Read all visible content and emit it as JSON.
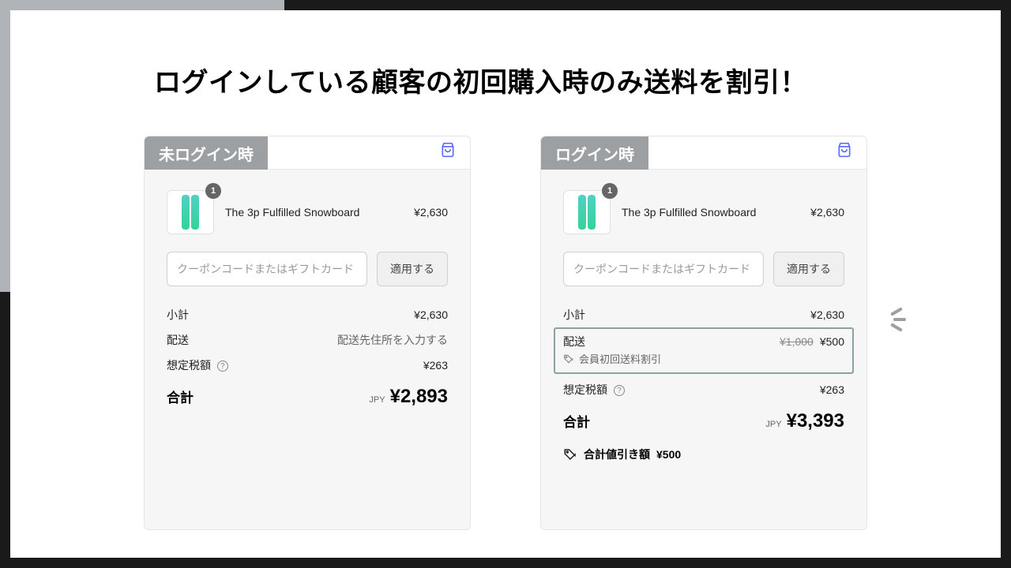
{
  "page_title": "ログインしている顧客の初回購入時のみ送料を割引！",
  "common": {
    "coupon_placeholder": "クーポンコードまたはギフトカード",
    "apply_label": "適用する",
    "subtotal_label": "小計",
    "shipping_label": "配送",
    "tax_label": "想定税額",
    "total_label": "合計",
    "currency": "JPY",
    "product": {
      "name": "The 3p Fulfilled Snowboard",
      "qty": "1",
      "price": "¥2,630"
    }
  },
  "left": {
    "tab": "未ログイン時",
    "subtotal": "¥2,630",
    "shipping_note": "配送先住所を入力する",
    "tax": "¥263",
    "total": "¥2,893"
  },
  "right": {
    "tab": "ログイン時",
    "subtotal": "¥2,630",
    "shipping_original": "¥1,000",
    "shipping_discounted": "¥500",
    "discount_name": "会員初回送料割引",
    "tax": "¥263",
    "total": "¥3,393",
    "savings_label": "合計値引き額",
    "savings_value": "¥500"
  }
}
